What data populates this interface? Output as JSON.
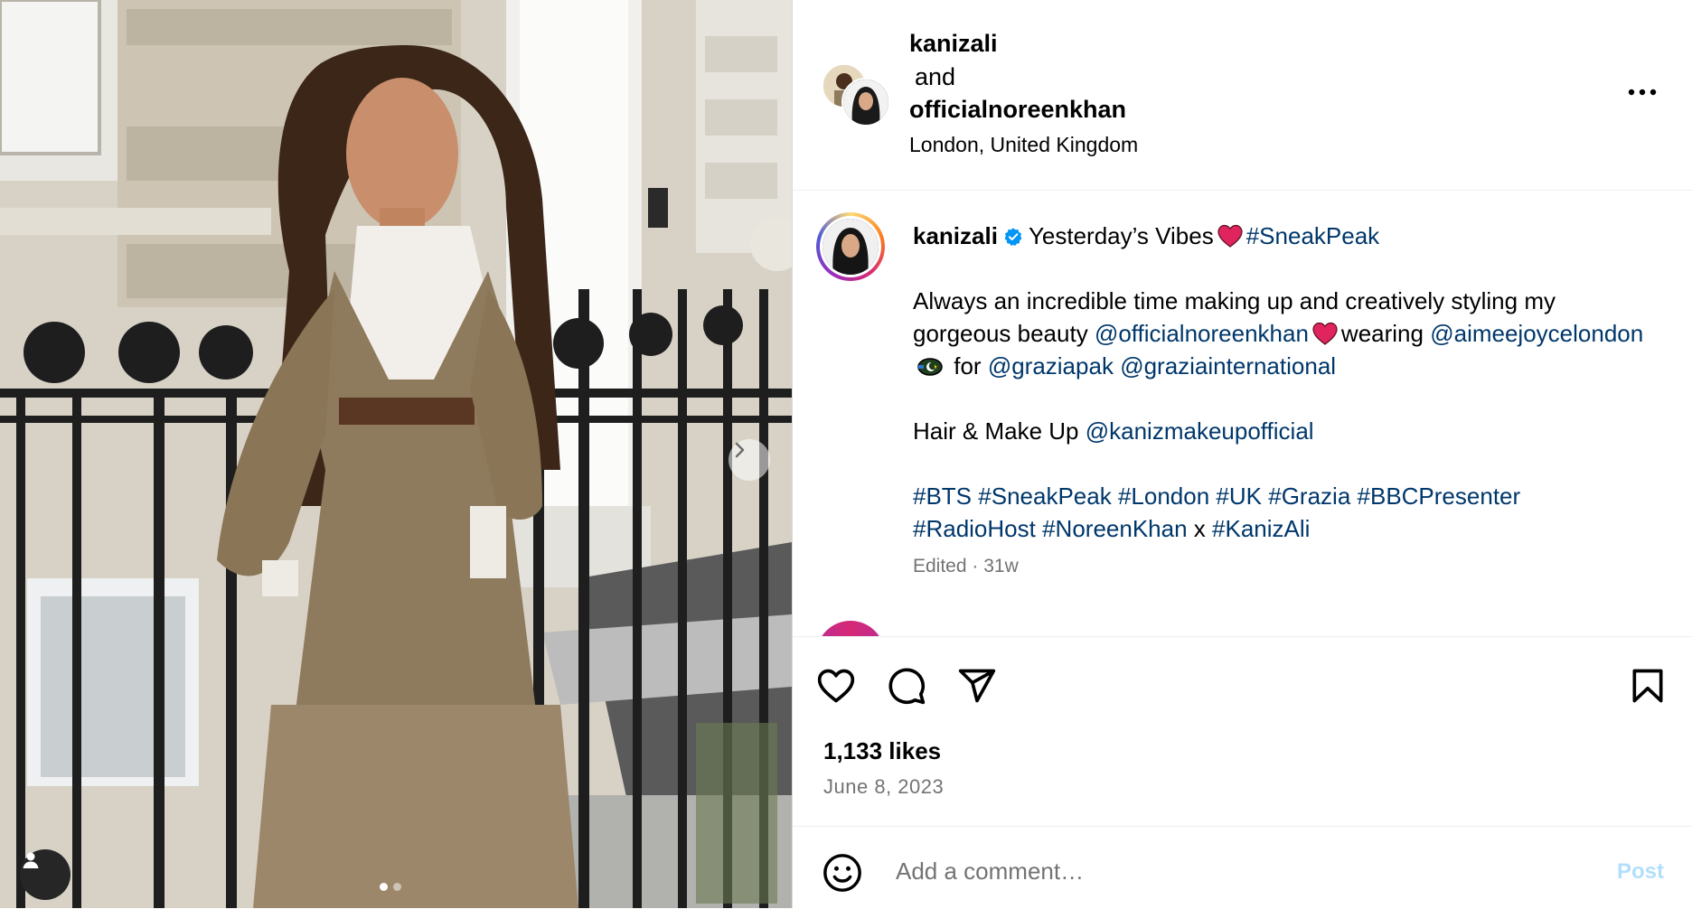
{
  "header": {
    "user1": "kanizali",
    "connector": "and",
    "user2": "officialnoreenkhan",
    "location": "London, United Kingdom"
  },
  "caption": {
    "username": "kanizali",
    "line1_text": "Yesterday’s Vibes",
    "line1_tag": "#SneakPeak",
    "para1_a": "Always an incredible time making up and creatively styling my gorgeous beauty",
    "para1_mention1": "@officialnoreenkhan",
    "para1_b": "wearing",
    "para1_mention2": "@aimeejoycelondon",
    "para1_c": "for",
    "para1_mention3": "@graziapak",
    "para1_mention4": "@graziainternational",
    "para2_text": "Hair & Make Up",
    "para2_mention": "@kanizmakeupofficial",
    "hashtags_line1": [
      "#BTS",
      "#SneakPeak",
      "#London",
      "#UK",
      "#Grazia",
      "#BBCPresenter"
    ],
    "hashtags_line2_a": "#RadioHost",
    "hashtags_line2_b": "#NoreenKhan",
    "hashtags_line2_x": "x",
    "hashtags_line2_c": "#KanizAli",
    "meta": "Edited · 31w"
  },
  "engagement": {
    "likes": "1,133 likes",
    "date": "June 8, 2023"
  },
  "comment": {
    "placeholder": "Add a comment…",
    "post_label": "Post"
  },
  "carousel": {
    "total": 2,
    "active": 1
  },
  "colors": {
    "link": "#00376b",
    "meta_gray": "#737373",
    "post_disabled": "#b2dffc",
    "heart_red": "#e0245e",
    "verified_blue": "#0095f6"
  }
}
